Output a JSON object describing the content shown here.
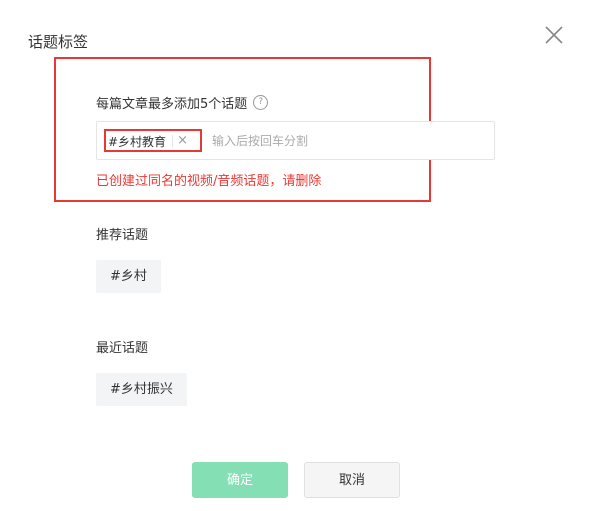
{
  "dialog": {
    "title": "话题标签",
    "close_icon": "close-icon"
  },
  "hint": {
    "text": "每篇文章最多添加5个话题",
    "help_symbol": "?"
  },
  "tag_input": {
    "tags": [
      {
        "label": "#乡村教育",
        "remove_symbol": "×"
      }
    ],
    "placeholder": "输入后按回车分割",
    "value": ""
  },
  "error": {
    "text": "已创建过同名的视频/音频话题，请删除"
  },
  "recommended": {
    "label": "推荐话题",
    "items": [
      "#乡村"
    ]
  },
  "recent": {
    "label": "最近话题",
    "items": [
      "#乡村振兴"
    ]
  },
  "buttons": {
    "confirm": "确定",
    "cancel": "取消"
  },
  "colors": {
    "highlight": "#e53935",
    "error": "#e53935",
    "confirm_bg": "#84dfb5",
    "chip_bg": "#f3f4f6"
  }
}
